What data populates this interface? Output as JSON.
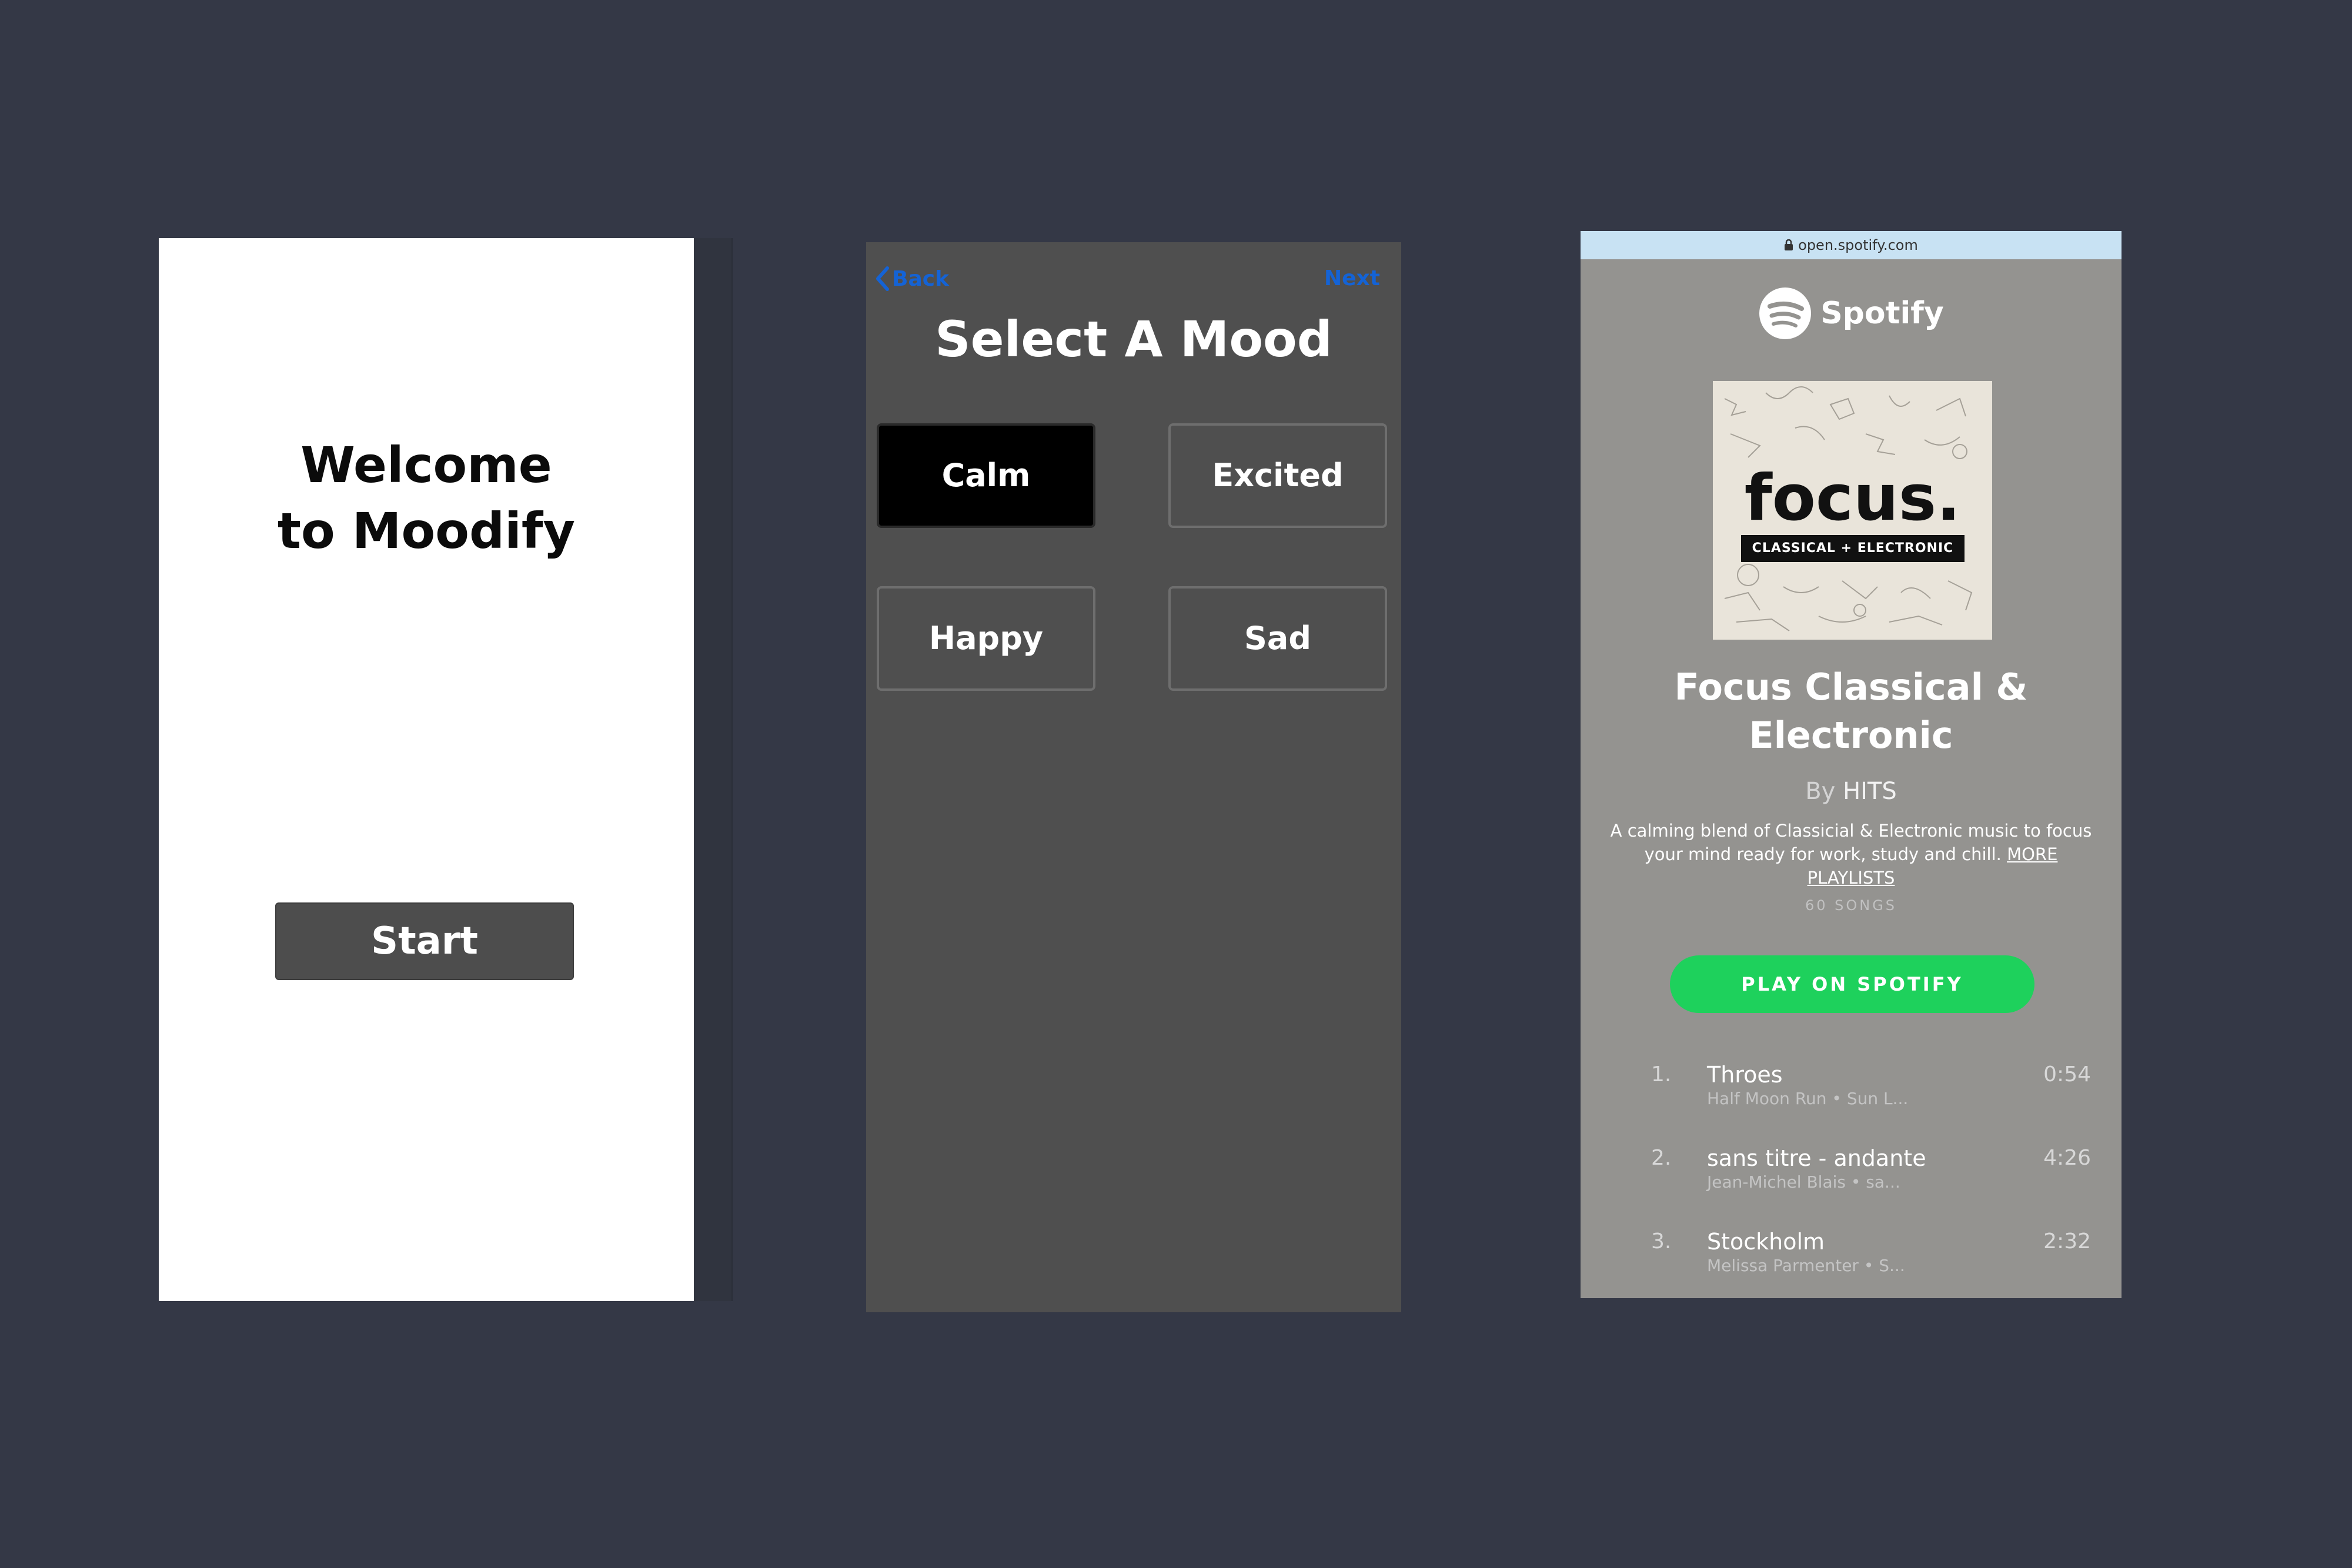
{
  "welcome_screen": {
    "title_line1": "Welcome",
    "title_line2": "to Moodify",
    "start_label": "Start"
  },
  "mood_screen": {
    "back_label": "Back",
    "next_label": "Next",
    "title": "Select A Mood",
    "moods": [
      {
        "label": "Calm",
        "selected": true
      },
      {
        "label": "Excited",
        "selected": false
      },
      {
        "label": "Happy",
        "selected": false
      },
      {
        "label": "Sad",
        "selected": false
      }
    ]
  },
  "spotify_screen": {
    "url": "open.spotify.com",
    "brand": "Spotify",
    "album_art": {
      "title": "focus.",
      "subtitle": "CLASSICAL + ELECTRONIC"
    },
    "playlist_title_line1": "Focus Classical &",
    "playlist_title_line2": "Electronic",
    "by_prefix": "By",
    "by_author": "HITS",
    "description": "A calming blend of Classicial & Electronic music to focus your mind ready for work, study and chill.",
    "more_link": "MORE PLAYLISTS",
    "song_count": "60 SONGS",
    "play_button": "PLAY ON SPOTIFY",
    "tracks": [
      {
        "num": "1.",
        "name": "Throes",
        "artist": "Half Moon Run • Sun L...",
        "time": "0:54"
      },
      {
        "num": "2.",
        "name": "sans titre - andante",
        "artist": "Jean-Michel Blais • sa...",
        "time": "4:26"
      },
      {
        "num": "3.",
        "name": "Stockholm",
        "artist": "Melissa Parmenter • S...",
        "time": "2:32"
      }
    ],
    "colors": {
      "play_button": "#1ed15c",
      "url_bar": "#c8e2f3",
      "link_blue": "#1463d6"
    }
  }
}
